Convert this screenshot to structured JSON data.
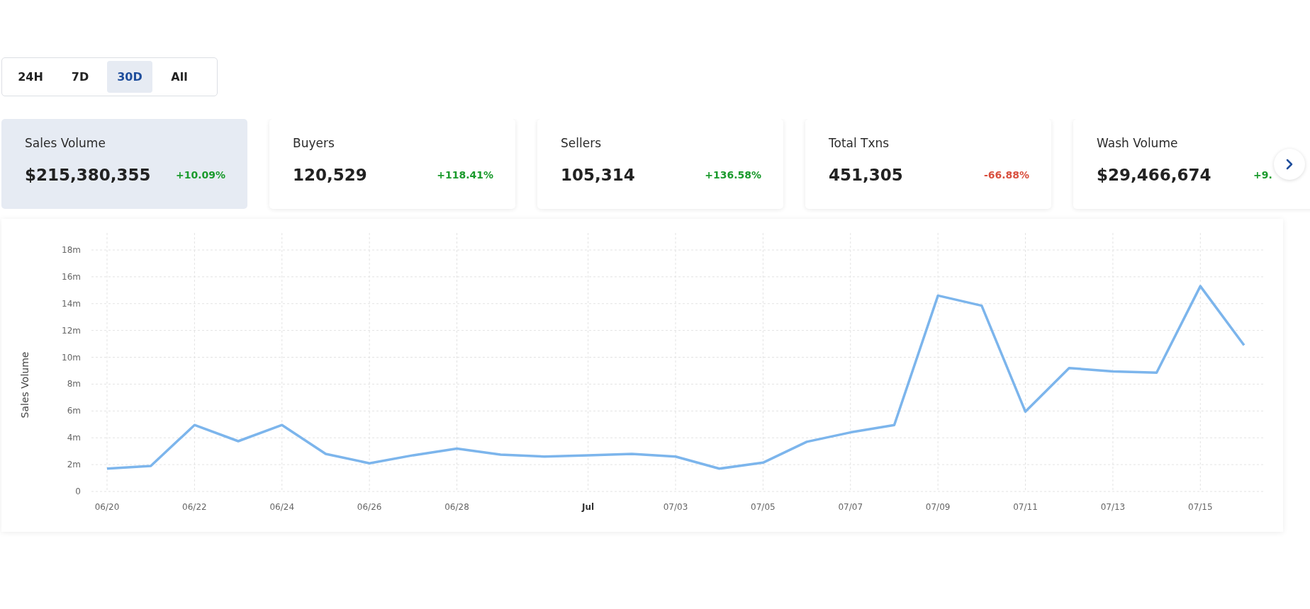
{
  "range_tabs": [
    {
      "label": "24H",
      "selected": false
    },
    {
      "label": "7D",
      "selected": false
    },
    {
      "label": "30D",
      "selected": true
    },
    {
      "label": "All",
      "selected": false
    }
  ],
  "stat_cards": [
    {
      "title": "Sales Volume",
      "value": "$215,380,355",
      "change": "+10.09%",
      "color": "#1a9a2c",
      "selected": true
    },
    {
      "title": "Buyers",
      "value": "120,529",
      "change": "+118.41%",
      "color": "#1a9a2c",
      "selected": false
    },
    {
      "title": "Sellers",
      "value": "105,314",
      "change": "+136.58%",
      "color": "#1a9a2c",
      "selected": false
    },
    {
      "title": "Total Txns",
      "value": "451,305",
      "change": "-66.88%",
      "color": "#d9503f",
      "selected": false
    },
    {
      "title": "Wash Volume",
      "value": "$29,466,674",
      "change": "+9.",
      "color": "#1a9a2c",
      "selected": false
    }
  ],
  "chart": {
    "chart_data": {
      "type": "line",
      "grid": true,
      "ylabel": "Sales Volume",
      "categories": [
        "06/20",
        null,
        "06/22",
        null,
        "06/24",
        null,
        "06/26",
        null,
        "06/28",
        null,
        null,
        "Jul",
        null,
        "07/03",
        null,
        "07/05",
        null,
        "07/07",
        null,
        "07/09",
        null,
        "07/11",
        null,
        "07/13",
        null,
        "07/15",
        null
      ],
      "series": [
        {
          "color": "#7cb5ec",
          "values": [
            1.7,
            1.9,
            4.95,
            3.75,
            4.95,
            2.8,
            2.1,
            2.7,
            3.2,
            2.75,
            2.6,
            2.7,
            2.8,
            2.6,
            1.7,
            2.15,
            3.7,
            4.4,
            4.95,
            14.6,
            13.85,
            5.95,
            9.2,
            8.95,
            8.85,
            15.3,
            10.9
          ]
        }
      ],
      "ylim": [
        0,
        18
      ],
      "yticks": [
        {
          "value": 0,
          "label": "0"
        },
        {
          "value": 2,
          "label": "2m"
        },
        {
          "value": 4,
          "label": "4m"
        },
        {
          "value": 6,
          "label": "6m"
        },
        {
          "value": 8,
          "label": "8m"
        },
        {
          "value": 10,
          "label": "10m"
        },
        {
          "value": 12,
          "label": "12m"
        },
        {
          "value": 14,
          "label": "14m"
        },
        {
          "value": 16,
          "label": "16m"
        },
        {
          "value": 18,
          "label": "18m"
        }
      ]
    }
  }
}
